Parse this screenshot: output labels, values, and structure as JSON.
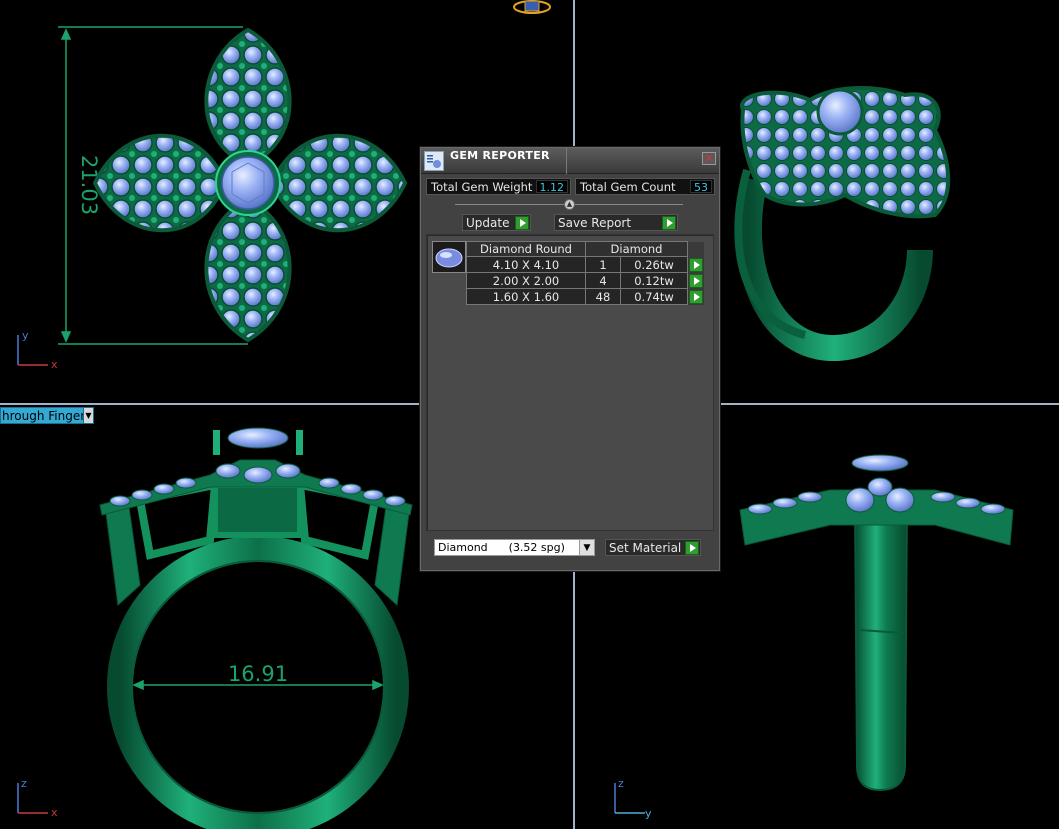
{
  "viewports": {
    "top_left": {
      "name": "front-view",
      "dimension": "21.03",
      "axis_labels": [
        "y",
        "x"
      ]
    },
    "top_right": {
      "name": "perspective-view"
    },
    "bottom_left": {
      "name": "through-finger-view",
      "dimension": "16.91",
      "axis_labels": [
        "z",
        "x"
      ]
    },
    "bottom_right": {
      "name": "side-view",
      "axis_labels": [
        "z",
        "y"
      ]
    }
  },
  "view_mode": {
    "label": "hrough Finger",
    "icon": "chevron-down-icon"
  },
  "gem_reporter": {
    "title": "GEM REPORTER",
    "close_icon": "close-icon",
    "total_weight_label": "Total Gem Weight",
    "total_weight_value": "1.12",
    "total_count_label": "Total Gem Count",
    "total_count_value": "53",
    "update_label": "Update",
    "save_report_label": "Save Report",
    "columns": [
      "Diamond Round",
      "Diamond"
    ],
    "rows": [
      {
        "size": "4.10 X 4.10",
        "count": "1",
        "weight": "0.26tw"
      },
      {
        "size": "2.00 X 2.00",
        "count": "4",
        "weight": "0.12tw"
      },
      {
        "size": "1.60 X 1.60",
        "count": "48",
        "weight": "0.74tw"
      }
    ],
    "material": "Diamond      (3.52 spg)",
    "set_material_label": "Set Material"
  },
  "colors": {
    "metal": "#0f7a4f",
    "metal_highlight": "#2fd394",
    "gem": "#8fa8f4",
    "gem_highlight": "#c9d8ff",
    "dimension": "#1aa36a",
    "splitter": "#9fb4c8",
    "value_text": "#36c8e0",
    "go_button": "#2f9d2f"
  }
}
